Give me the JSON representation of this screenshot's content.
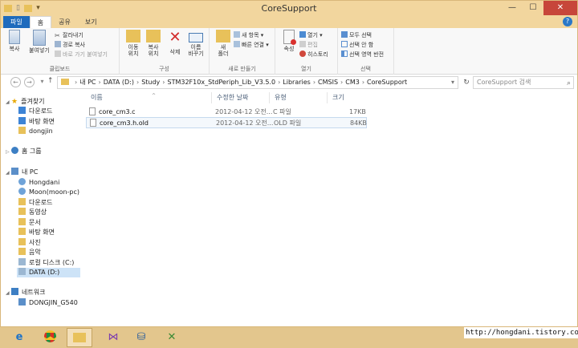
{
  "window": {
    "title": "CoreSupport",
    "controls": {
      "minimize": "—",
      "maximize": "☐",
      "close": "✕"
    }
  },
  "ribbon_tabs": [
    {
      "label": "파일",
      "state": "file"
    },
    {
      "label": "홈",
      "state": "active"
    },
    {
      "label": "공유",
      "state": ""
    },
    {
      "label": "보기",
      "state": ""
    }
  ],
  "ribbon": {
    "clipboard": {
      "label": "클립보드",
      "copy": "복사",
      "paste": "붙여넣기",
      "cut": "잘라내기",
      "copy_path": "경로 복사",
      "paste_shortcut": "바로 가기 붙여넣기"
    },
    "organize": {
      "label": "구성",
      "move_to": "이동\n위치",
      "copy_to": "복사\n위치",
      "delete": "삭제",
      "rename": "이름\n바꾸기"
    },
    "new": {
      "label": "새로 만들기",
      "new_folder": "새\n폴더",
      "new_item": "새 항목",
      "easy_access": "빠른 연결"
    },
    "open": {
      "label": "열기",
      "properties": "속성",
      "open": "열기",
      "edit": "편집",
      "history": "히스토리"
    },
    "select": {
      "label": "선택",
      "select_all": "모두 선택",
      "select_none": "선택 안 함",
      "invert": "선택 영역 반전"
    }
  },
  "address": {
    "segments": [
      "내 PC",
      "DATA (D:)",
      "Study",
      "STM32F10x_StdPeriph_Lib_V3.5.0",
      "Libraries",
      "CMSIS",
      "CM3",
      "CoreSupport"
    ],
    "search_placeholder": "CoreSupport 검색"
  },
  "nav": {
    "favorites": "즐겨찾기",
    "fav_items": [
      "다운로드",
      "바탕 화면",
      "dongjin"
    ],
    "homegroup": "홈 그룹",
    "this_pc": "내 PC",
    "pc_items": [
      "Hongdani",
      "Moon(moon-pc)",
      "다운로드",
      "동영상",
      "문서",
      "바탕 화면",
      "사진",
      "음악",
      "로컬 디스크 (C:)",
      "DATA (D:)"
    ],
    "network": "네트워크",
    "net_items": [
      "DONGJIN_G540"
    ]
  },
  "columns": {
    "name": "이름",
    "date": "수정한 날짜",
    "type": "유형",
    "size": "크기"
  },
  "files": [
    {
      "name": "core_cm3.c",
      "date": "2012-04-12 오전...",
      "type": "C 파일",
      "size": "17KB"
    },
    {
      "name": "core_cm3.h.old",
      "date": "2012-04-12 오전...",
      "type": "OLD 파일",
      "size": "84KB"
    }
  ],
  "taskbar": {
    "url_overlay": "http://hongdani.tistory.com"
  }
}
